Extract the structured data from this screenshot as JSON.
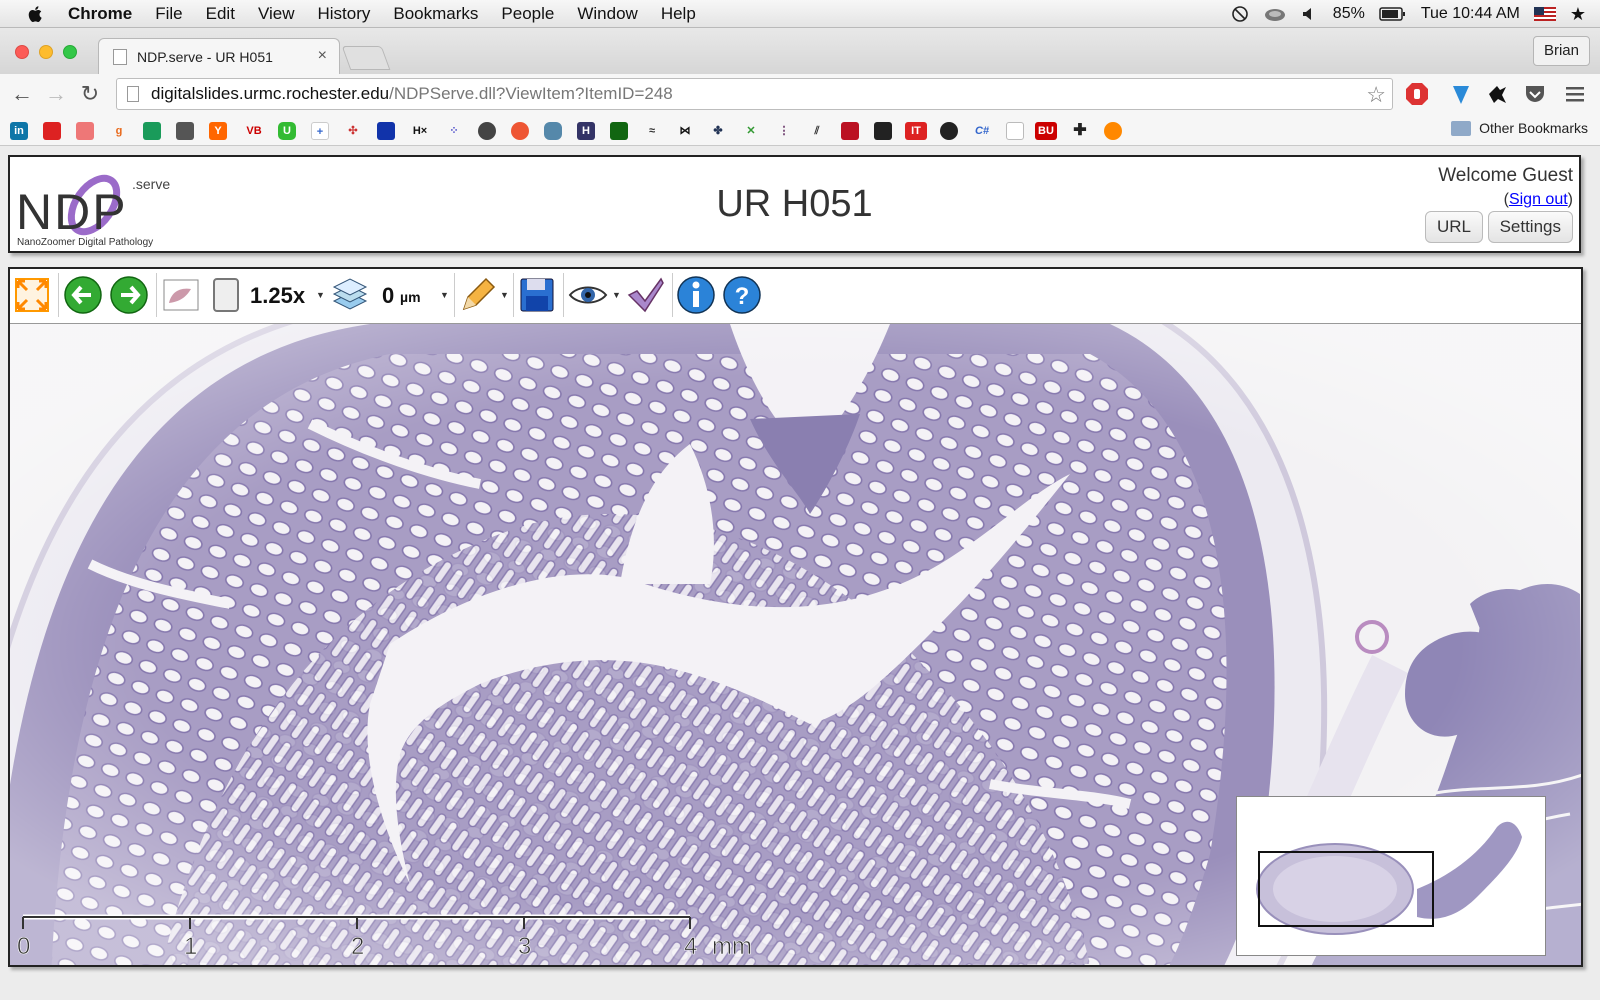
{
  "menubar": {
    "items": [
      {
        "label": "Chrome",
        "bold": true
      },
      {
        "label": "File"
      },
      {
        "label": "Edit"
      },
      {
        "label": "View"
      },
      {
        "label": "History"
      },
      {
        "label": "Bookmarks"
      },
      {
        "label": "People"
      },
      {
        "label": "Window"
      },
      {
        "label": "Help"
      }
    ],
    "battery": "85%",
    "clock": "Tue 10:44 AM"
  },
  "browser": {
    "tab_title": "NDP.serve - UR H051",
    "tab_close": "×",
    "profile": "Brian",
    "url_host": "digitalslides.urmc.rochester.edu",
    "url_path": "/NDPServe.dll?ViewItem?ItemID=248",
    "other_bookmarks": "Other Bookmarks",
    "bookmark_labels": [
      "in",
      "Y",
      "VB",
      "U",
      "H×",
      "C#",
      "BU"
    ]
  },
  "ndp": {
    "logo": {
      "main": "NDP",
      "suffix": ".serve",
      "tagline": "NanoZoomer Digital Pathology"
    },
    "slide_title": "UR H051",
    "welcome": "Welcome Guest",
    "signout_open": "(",
    "signout_label": "Sign out",
    "signout_close": ")",
    "url_button": "URL",
    "settings_button": "Settings"
  },
  "toolbar": {
    "magnification": "1.25x",
    "z_offset": "0",
    "z_unit": "µm"
  },
  "scalebar": {
    "ticks": [
      "0",
      "1",
      "2",
      "3",
      "4"
    ],
    "unit": "mm"
  },
  "colors": {
    "tissue": "#a89dc4",
    "tissue_dark": "#7d6fa3",
    "slide_bg": "#f3f2f4",
    "logo_purple": "#9b6bc9"
  }
}
